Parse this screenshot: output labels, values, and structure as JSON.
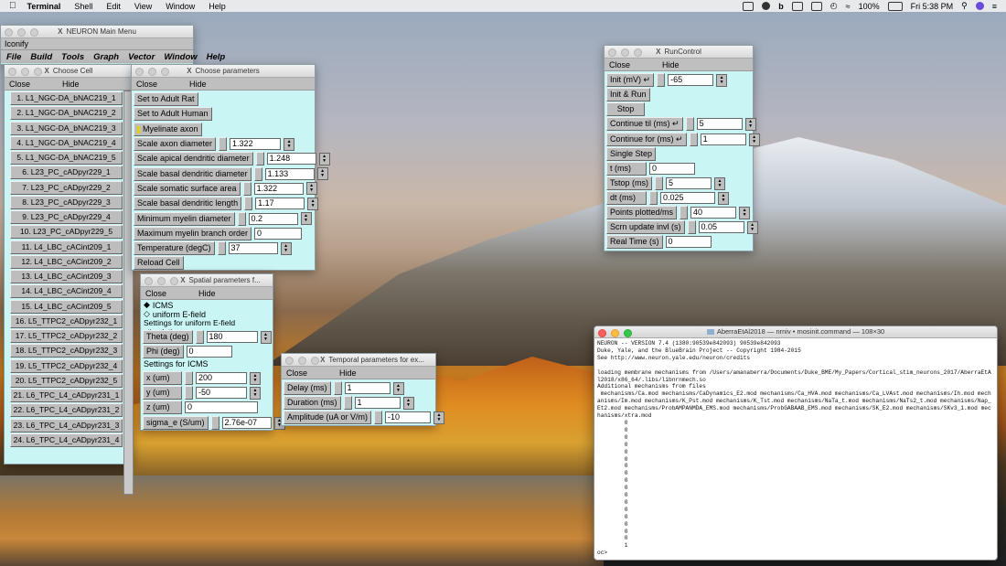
{
  "menubar": {
    "apple": "",
    "app": "Terminal",
    "items": [
      "Shell",
      "Edit",
      "View",
      "Window",
      "Help"
    ],
    "battery": "100%",
    "clock": "Fri 5:38 PM"
  },
  "main_menu": {
    "title": "NEURON Main Menu",
    "iconify": "Iconify",
    "items": [
      "File",
      "Build",
      "Tools",
      "Graph",
      "Vector",
      "Window",
      "Help"
    ]
  },
  "choose_cell": {
    "title": "Choose Cell",
    "close": "Close",
    "hide": "Hide",
    "cells": [
      "1. L1_NGC-DA_bNAC219_1",
      "2. L1_NGC-DA_bNAC219_2",
      "3. L1_NGC-DA_bNAC219_3",
      "4. L1_NGC-DA_bNAC219_4",
      "5. L1_NGC-DA_bNAC219_5",
      "6. L23_PC_cADpyr229_1",
      "7. L23_PC_cADpyr229_2",
      "8. L23_PC_cADpyr229_3",
      "9. L23_PC_cADpyr229_4",
      "10. L23_PC_cADpyr229_5",
      "11. L4_LBC_cACint209_1",
      "12. L4_LBC_cACint209_2",
      "13. L4_LBC_cACint209_3",
      "14. L4_LBC_cACint209_4",
      "15. L4_LBC_cACint209_5",
      "16. L5_TTPC2_cADpyr232_1",
      "17. L5_TTPC2_cADpyr232_2",
      "18. L5_TTPC2_cADpyr232_3",
      "19. L5_TTPC2_cADpyr232_4",
      "20. L5_TTPC2_cADpyr232_5",
      "21. L6_TPC_L4_cADpyr231_1",
      "22. L6_TPC_L4_cADpyr231_2",
      "23. L6_TPC_L4_cADpyr231_3",
      "24. L6_TPC_L4_cADpyr231_4"
    ]
  },
  "choose_params": {
    "title": "Choose parameters",
    "close": "Close",
    "hide": "Hide",
    "adult_rat": "Set to Adult Rat",
    "adult_human": "Set to Adult Human",
    "myelinate": "Myelinate axon",
    "params": [
      {
        "label": "Scale axon diameter",
        "value": "1.322"
      },
      {
        "label": "Scale apical dendritic diameter",
        "value": "1.248"
      },
      {
        "label": "Scale basal dendritic diameter",
        "value": "1.133"
      },
      {
        "label": "Scale somatic surface area",
        "value": "1.322"
      },
      {
        "label": "Scale basal dendritic length",
        "value": "1.17"
      },
      {
        "label": "Minimum myelin diameter",
        "value": "0.2"
      },
      {
        "label": "Maximum myelin branch order",
        "value": "0"
      },
      {
        "label": "Temperature (degC)",
        "value": "37"
      }
    ],
    "reload": "Reload Cell"
  },
  "spatial": {
    "title": "Spatial parameters f...",
    "close": "Close",
    "hide": "Hide",
    "icms": "ICMS",
    "efield": "uniform E-field",
    "efield_heading": "Settings for uniform E-field stimulation",
    "theta_label": "Theta (deg)",
    "theta": "180",
    "phi_label": "Phi (deg)",
    "phi": "0",
    "icms_heading": "Settings for ICMS",
    "x_label": "x (um)",
    "x": "200",
    "y_label": "y (um)",
    "y": "-50",
    "z_label": "z (um)",
    "z": "0",
    "sigma_label": "sigma_e (S/um)",
    "sigma": "2.76e-07"
  },
  "temporal": {
    "title": "Temporal parameters for ex...",
    "close": "Close",
    "hide": "Hide",
    "delay_label": "Delay (ms)",
    "delay": "1",
    "duration_label": "Duration (ms)",
    "duration": "1",
    "amp_label": "Amplitude (uA or V/m)",
    "amp": "-10"
  },
  "runcontrol": {
    "title": "RunControl",
    "close": "Close",
    "hide": "Hide",
    "init_label": "Init (mV)",
    "init": "-65",
    "init_run": "Init & Run",
    "stop": "Stop",
    "continue_til_label": "Continue til (ms)",
    "continue_til": "5",
    "continue_for_label": "Continue for (ms)",
    "continue_for": "1",
    "single_step": "Single Step",
    "t_label": "t (ms)",
    "t": "0",
    "tstop_label": "Tstop (ms)",
    "tstop": "5",
    "dt_label": "dt (ms)",
    "dt": "0.025",
    "points_label": "Points plotted/ms",
    "points": "40",
    "scrn_label": "Scrn update invl (s)",
    "scrn": "0.05",
    "realtime_label": "Real Time (s)",
    "realtime": "0"
  },
  "terminal": {
    "title": "AberraEtAl2018 — nrniv • mosinit.command — 108×30",
    "text": "NEURON -- VERSION 7.4 (1380:90539e842093) 90539e842093\nDuke, Yale, and the BlueBrain Project -- Copyright 1984-2015\nSee http://www.neuron.yale.edu/neuron/credits\n\nloading membrane mechanisms from /Users/amanaberra/Documents/Duke_BME/My_Papers/Cortical_stim_neurons_2017/AberraEtAl2018/x86_64/.libs/libnrnmech.so\nAdditional mechanisms from files\n mechanisms/Ca.mod mechanisms/CaDynamics_E2.mod mechanisms/Ca_HVA.mod mechanisms/Ca_LVAst.mod mechanisms/Ih.mod mechanisms/Im.mod mechanisms/K_Pst.mod mechanisms/K_Tst.mod mechanisms/NaTa_t.mod mechanisms/NaTs2_t.mod mechanisms/Nap_Et2.mod mechanisms/ProbAMPANMDA_EMS.mod mechanisms/ProbGABAAB_EMS.mod mechanisms/SK_E2.mod mechanisms/SKv3_1.mod mechanisms/xtra.mod\n\t0\n\t0\n\t0\n\t0\n\t0\n\t0\n\t0\n\t0\n\t0\n\t0\n\t0\n\t0\n\t0\n\t0\n\t0\n\t0\n\t0\n\t1\noc>"
  }
}
